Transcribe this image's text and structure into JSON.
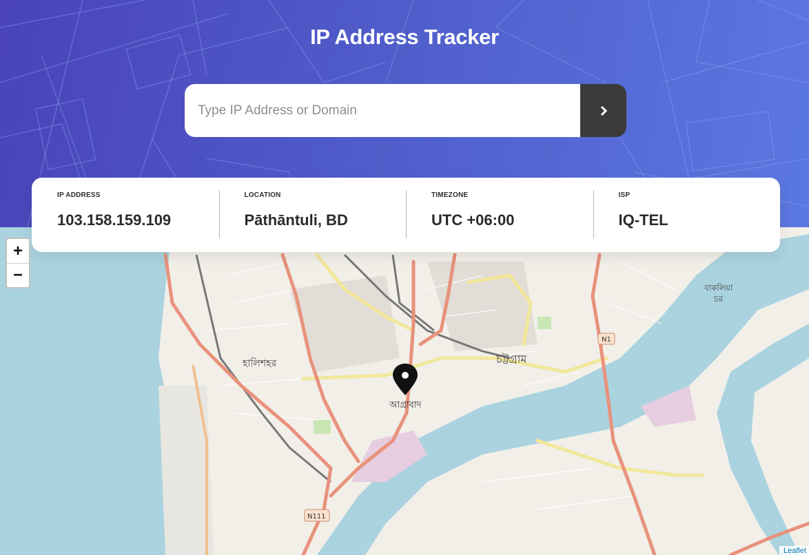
{
  "header": {
    "title": "IP Address Tracker"
  },
  "search": {
    "placeholder": "Type IP Address or Domain",
    "value": "",
    "submit_icon": "chevron-right-icon"
  },
  "info": {
    "ip_label": "IP ADDRESS",
    "ip_value": "103.158.159.109",
    "location_label": "LOCATION",
    "location_value": "Pāthāntuli, BD",
    "timezone_label": "TIMEZONE",
    "timezone_value": "UTC +06:00",
    "isp_label": "ISP",
    "isp_value": "IQ-TEL"
  },
  "map": {
    "zoom_in": "+",
    "zoom_out": "−",
    "marker_icon": "location-pin-icon",
    "marker_label": "আগ্রাবাদ",
    "labels": {
      "city": "চট্টগ্রাম",
      "halishahar": "হালিশহর",
      "bakalia_1": "বাকলিয়া",
      "bakalia_2": "চর",
      "n1": "N1",
      "n111": "N111"
    },
    "attribution": "Leaflet"
  },
  "colors": {
    "header_gradient_start": "#4a43b8",
    "header_gradient_end": "#5b78e0",
    "button_dark": "#3b3b3b",
    "text_dark": "#2b2b2b",
    "water": "#aad3df",
    "land": "#f2efe9",
    "primary_road": "#e8927c",
    "secondary_road": "#f7fabf"
  }
}
